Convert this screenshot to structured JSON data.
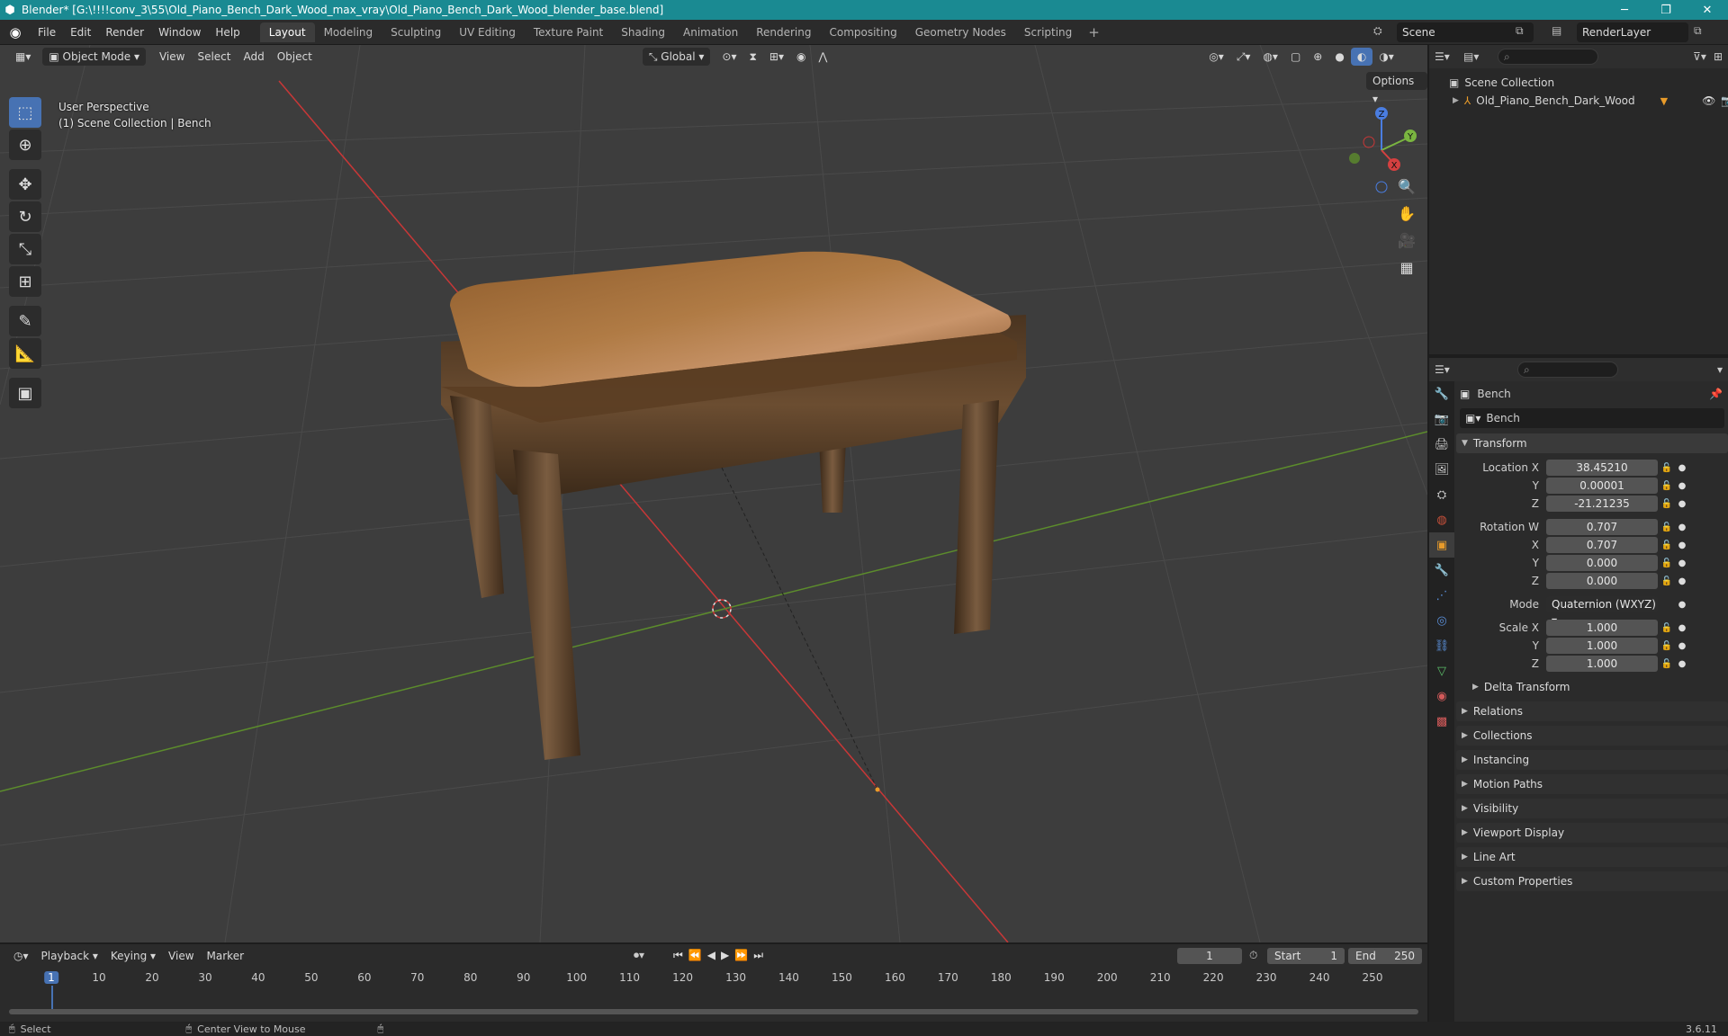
{
  "titlebar": {
    "title": "Blender* [G:\\!!!!conv_3\\55\\Old_Piano_Bench_Dark_Wood_max_vray\\Old_Piano_Bench_Dark_Wood_blender_base.blend]",
    "minimize": "─",
    "maximize": "❐",
    "close": "✕"
  },
  "menu": {
    "items": [
      "File",
      "Edit",
      "Render",
      "Window",
      "Help"
    ]
  },
  "workspaces": [
    "Layout",
    "Modeling",
    "Sculpting",
    "UV Editing",
    "Texture Paint",
    "Shading",
    "Animation",
    "Rendering",
    "Compositing",
    "Geometry Nodes",
    "Scripting"
  ],
  "workspace_add": "+",
  "scene": {
    "name": "Scene",
    "layer": "RenderLayer"
  },
  "viewport": {
    "mode": "Object Mode",
    "menus": [
      "View",
      "Select",
      "Add",
      "Object"
    ],
    "orientation": "Global",
    "options": "Options",
    "perspective": "User Perspective",
    "collection_info": "(1) Scene Collection | Bench",
    "gizmo": {
      "x": "X",
      "y": "Y",
      "z": "Z"
    }
  },
  "outliner": {
    "search_placeholder": "",
    "root": "Scene Collection",
    "object": "Old_Piano_Bench_Dark_Wood"
  },
  "properties": {
    "object_name": "Bench",
    "data_name": "Bench",
    "transform_title": "Transform",
    "location": {
      "label": "Location X",
      "x": "38.45210",
      "y": "0.00001",
      "z": "-21.21235"
    },
    "rotation": {
      "label": "Rotation W",
      "w": "0.707",
      "x": "0.707",
      "y": "0.000",
      "z": "0.000"
    },
    "mode": {
      "label": "Mode",
      "value": "Quaternion (WXYZ)"
    },
    "scale": {
      "label": "Scale X",
      "x": "1.000",
      "y": "1.000",
      "z": "1.000"
    },
    "axis_y": "Y",
    "axis_x": "X",
    "axis_z": "Z",
    "delta": "Delta Transform",
    "sections": [
      "Relations",
      "Collections",
      "Instancing",
      "Motion Paths",
      "Visibility",
      "Viewport Display",
      "Line Art",
      "Custom Properties"
    ]
  },
  "timeline": {
    "menus": [
      "Playback",
      "Keying",
      "View",
      "Marker"
    ],
    "current_frame": "1",
    "start_label": "Start",
    "start": "1",
    "end_label": "End",
    "end": "250",
    "ticks": [
      "1",
      "10",
      "20",
      "30",
      "40",
      "50",
      "60",
      "70",
      "80",
      "90",
      "100",
      "110",
      "120",
      "130",
      "140",
      "150",
      "160",
      "170",
      "180",
      "190",
      "200",
      "210",
      "220",
      "230",
      "240",
      "250"
    ]
  },
  "status": {
    "select": "Select",
    "center": "Center View to Mouse",
    "version": "3.6.11"
  },
  "colors": {
    "titlebar": "#1a8a92",
    "accent": "#4772b3",
    "x_axis": "#c83737",
    "y_axis": "#5c8c2c"
  }
}
